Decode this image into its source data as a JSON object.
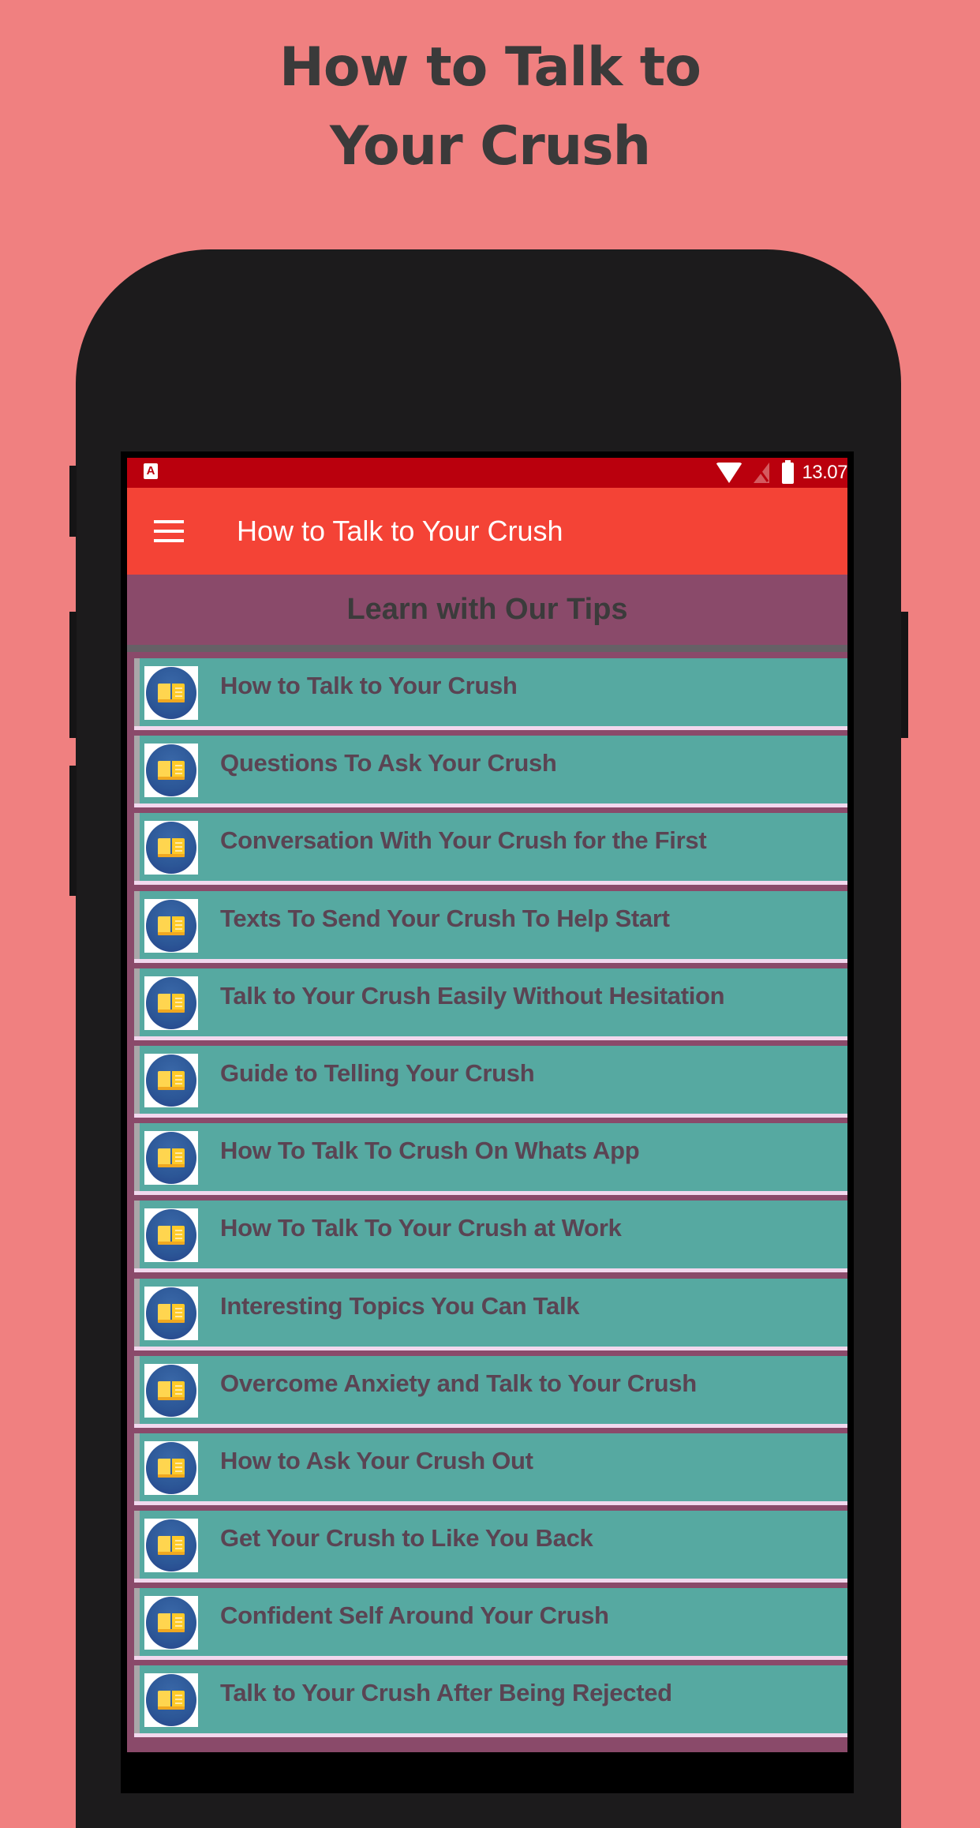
{
  "promo": {
    "title_line1": "How to Talk to",
    "title_line2": "Your Crush"
  },
  "status_bar": {
    "left_icon": "A",
    "left_icon_name": "notification-a-icon",
    "icons": [
      "wifi-icon",
      "no-signal-icon",
      "battery-icon"
    ],
    "time": "13.07"
  },
  "app_bar": {
    "menu_icon": "hamburger-menu-icon",
    "title": "How to Talk to Your Crush"
  },
  "header": {
    "title": "Learn with Our Tips"
  },
  "list": {
    "item_icon": "book-icon",
    "items": [
      {
        "label": "How to Talk to Your Crush"
      },
      {
        "label": "Questions To Ask Your Crush"
      },
      {
        "label": "Conversation With Your Crush for the First"
      },
      {
        "label": "Texts To Send Your Crush To Help Start"
      },
      {
        "label": "Talk to Your Crush Easily Without Hesitation"
      },
      {
        "label": "Guide to Telling Your Crush"
      },
      {
        "label": "How To Talk To Crush On Whats App"
      },
      {
        "label": "How To Talk To Your Crush at Work"
      },
      {
        "label": "Interesting Topics You Can Talk"
      },
      {
        "label": "Overcome Anxiety and Talk to Your Crush"
      },
      {
        "label": "How to Ask Your Crush Out"
      },
      {
        "label": "Get Your Crush to Like You Back"
      },
      {
        "label": "Confident Self Around Your Crush"
      },
      {
        "label": "Talk to Your Crush After Being Rejected"
      }
    ]
  },
  "colors": {
    "background": "#F08080",
    "status_bar": "#BA000D",
    "app_bar": "#F44336",
    "header_band": "#8A4A6A",
    "list_item": "#56A9A1",
    "list_text": "#5A4453",
    "phone_body": "#1C1B1C"
  }
}
